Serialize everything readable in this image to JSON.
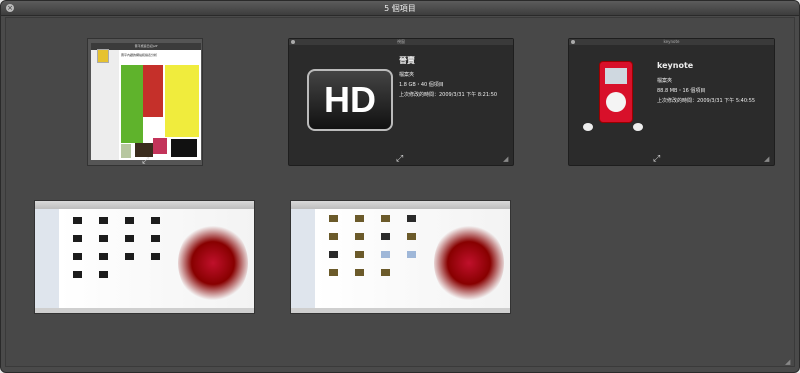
{
  "window": {
    "title": "5 個項目"
  },
  "doc_preview": {
    "header": "晋平旅遊日記pdf",
    "doc_title": "晋平內鑽的網站和總表分析"
  },
  "hd_panel": {
    "window_title": "視窗",
    "icon_text": "HD",
    "name": "晉賣",
    "kind": "檔案夾",
    "size": "1.8 GB・40 個項目",
    "modified": "上次修改的時間：2009/3/31 下午 8:21:50"
  },
  "keynote_panel": {
    "window_title": "keynote",
    "name": "keynote",
    "kind": "檔案夾",
    "size": "88.8 MB・16 個項目",
    "modified": "上次修改的時間：2009/3/31 下午 5:40:55"
  },
  "icons": [
    "close-icon",
    "expand-icon",
    "resize-grip-icon"
  ],
  "colors": {
    "background": "#4a4a4a",
    "panel": "#2b2b2b",
    "ipod_red": "#d8102a"
  }
}
